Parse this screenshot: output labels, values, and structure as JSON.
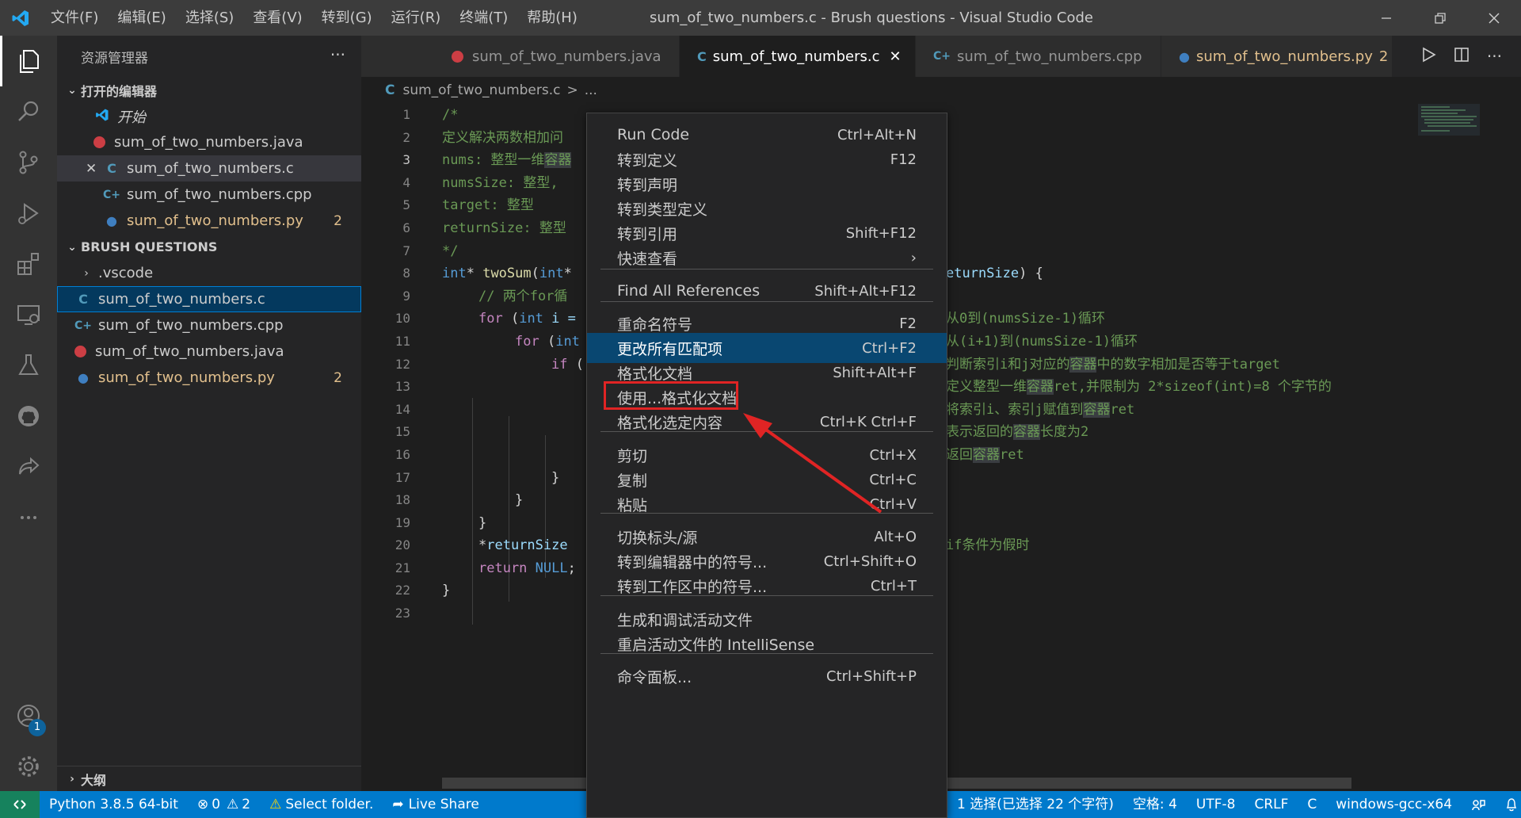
{
  "window": {
    "title": "sum_of_two_numbers.c - Brush questions - Visual Studio Code"
  },
  "menubar": [
    "文件(F)",
    "编辑(E)",
    "选择(S)",
    "查看(V)",
    "转到(G)",
    "运行(R)",
    "终端(T)",
    "帮助(H)"
  ],
  "activity": {
    "account_badge": "1"
  },
  "sidebar": {
    "title": "资源管理器",
    "open_editors_header": "打开的编辑器",
    "open_editors": [
      {
        "label": "开始",
        "type": "vscode"
      },
      {
        "label": "sum_of_two_numbers.java",
        "type": "java"
      },
      {
        "label": "sum_of_two_numbers.c",
        "type": "c"
      },
      {
        "label": "sum_of_two_numbers.cpp",
        "type": "cpp"
      },
      {
        "label": "sum_of_two_numbers.py",
        "type": "py",
        "count": "2"
      }
    ],
    "folder_header": "BRUSH QUESTIONS",
    "folder_items": [
      {
        "label": ".vscode",
        "type": "folder"
      },
      {
        "label": "sum_of_two_numbers.c",
        "type": "c"
      },
      {
        "label": "sum_of_two_numbers.cpp",
        "type": "cpp"
      },
      {
        "label": "sum_of_two_numbers.java",
        "type": "java"
      },
      {
        "label": "sum_of_two_numbers.py",
        "type": "py",
        "count": "2"
      }
    ],
    "outline_header": "大纲"
  },
  "tabs": [
    {
      "label": "sum_of_two_numbers.java",
      "type": "java"
    },
    {
      "label": "sum_of_two_numbers.c",
      "type": "c"
    },
    {
      "label": "sum_of_two_numbers.cpp",
      "type": "cpp"
    },
    {
      "label": "sum_of_two_numbers.py",
      "type": "py",
      "count": "2"
    }
  ],
  "breadcrumb": {
    "icon": "C",
    "file": "sum_of_two_numbers.c",
    "sep": ">",
    "more": "..."
  },
  "editor": {
    "line_numbers": [
      "1",
      "2",
      "3",
      "4",
      "5",
      "6",
      "7",
      "8",
      "9",
      "10",
      "11",
      "12",
      "13",
      "14",
      "15",
      "16",
      "17",
      "18",
      "19",
      "20",
      "21",
      "22",
      "23"
    ],
    "current_line": "3",
    "code": {
      "l1": "/*",
      "l2": "定义解决两数相加问",
      "l3a": "nums: 整型一维",
      "l3b": "容器",
      "l4": "numsSize: 整型,",
      "l5": "target: 整型",
      "l6": "returnSize: 整型",
      "l7": "*/",
      "l8a": "int",
      "l8b": "* ",
      "l8c": "twoSum",
      "l8d": "(",
      "l8e": "int",
      "l8f": "*",
      "l8g": "eturnSize",
      ") {": ") {",
      "l9": "// 两个for循",
      "l10a": "for",
      "l10b": " (",
      "l10c": "int",
      "l10d": " i =",
      "l11a": "for",
      "l11b": " (",
      "l11c": "int",
      "l12a": "if",
      "l12b": " (",
      "l17": "}",
      "l18": "}",
      "l19": "}",
      "l20a": "*",
      "l20b": "returnSize",
      "l21a": "return",
      "l21b": " NULL",
      "l21c": ";",
      "l22": "}",
      "r10": "从0到(numsSize-1)循环",
      "r11": "从(i+1)到(numsSize-1)循环",
      "r12a": "判断索引i和j对应的",
      "r12b": "容器",
      "r12c": "中的数字相加是否等于target",
      "r13a": "定义整型一维",
      "r13b": "容器",
      "r13c": "ret,并限制为 2*sizeof(int)=8 个字节的",
      "r14a": "将索引i、索引j赋值到",
      "r14b": "容器",
      "r14c": "ret",
      "r15a": "表示返回的",
      "r15b": "容器",
      "r15c": "长度为2",
      "r16a": "返回",
      "r16b": "容器",
      "r16c": "ret",
      "r20": "if条件为假时"
    }
  },
  "context_menu": [
    {
      "label": "Run Code",
      "kb": "Ctrl+Alt+N"
    },
    {
      "label": "转到定义",
      "kb": "F12"
    },
    {
      "label": "转到声明",
      "kb": ""
    },
    {
      "label": "转到类型定义",
      "kb": ""
    },
    {
      "label": "转到引用",
      "kb": "Shift+F12"
    },
    {
      "label": "快速查看",
      "kb": "›"
    },
    {
      "label": "Find All References",
      "kb": "Shift+Alt+F12"
    },
    {
      "label": "重命名符号",
      "kb": "F2"
    },
    {
      "label": "更改所有匹配项",
      "kb": "Ctrl+F2"
    },
    {
      "label": "格式化文档",
      "kb": "Shift+Alt+F"
    },
    {
      "label": "使用...格式化文档",
      "kb": ""
    },
    {
      "label": "格式化选定内容",
      "kb": "Ctrl+K Ctrl+F"
    },
    {
      "label": "剪切",
      "kb": "Ctrl+X"
    },
    {
      "label": "复制",
      "kb": "Ctrl+C"
    },
    {
      "label": "粘贴",
      "kb": "Ctrl+V"
    },
    {
      "label": "切换标头/源",
      "kb": "Alt+O"
    },
    {
      "label": "转到编辑器中的符号...",
      "kb": "Ctrl+Shift+O"
    },
    {
      "label": "转到工作区中的符号...",
      "kb": "Ctrl+T"
    },
    {
      "label": "生成和调试活动文件",
      "kb": ""
    },
    {
      "label": "重启活动文件的 IntelliSense",
      "kb": ""
    },
    {
      "label": "命令面板...",
      "kb": "Ctrl+Shift+P"
    }
  ],
  "statusbar": {
    "python": "Python 3.8.5 64-bit",
    "errors": "0",
    "warnings": "2",
    "select_folder": "Select folder.",
    "live_share": "Live Share",
    "selection": "1 选择(已选择 22 个字符)",
    "spaces": "空格: 4",
    "encoding": "UTF-8",
    "eol": "CRLF",
    "language": "C",
    "config": "windows-gcc-x64"
  },
  "colors": {
    "accent": "#007acc",
    "selected": "#094771",
    "highlight_box": "#e02424",
    "python_warn": "#e2c08d"
  }
}
